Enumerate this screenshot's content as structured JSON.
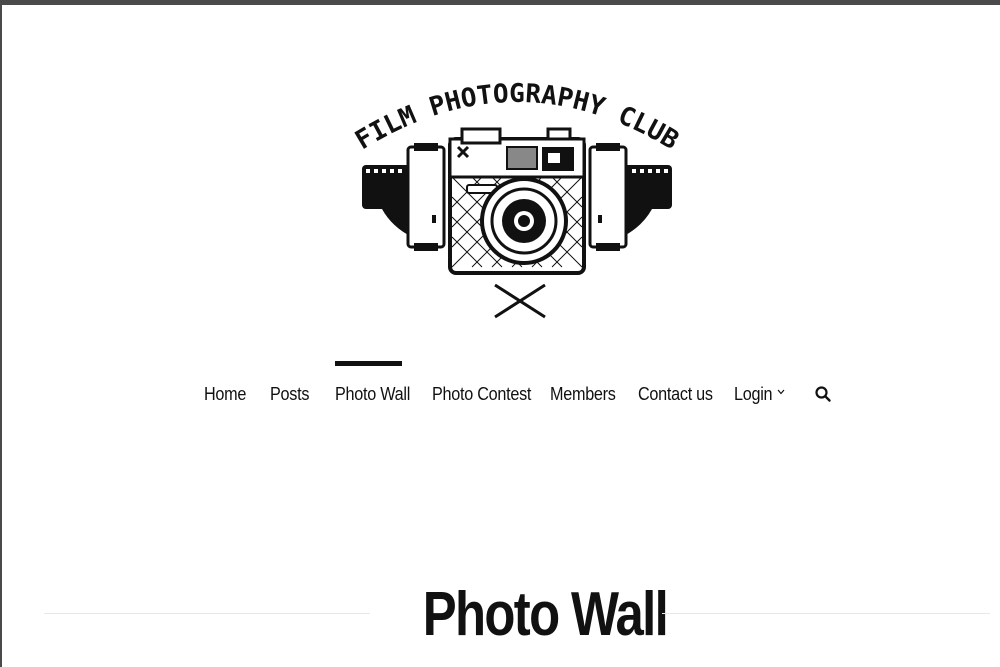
{
  "site": {
    "logo_text": "FILM PHOTOGRAPHY CLUB"
  },
  "nav": {
    "items": [
      {
        "label": "Home"
      },
      {
        "label": "Posts"
      },
      {
        "label": "Photo Wall",
        "active": true
      },
      {
        "label": "Photo Contest"
      },
      {
        "label": "Members"
      },
      {
        "label": "Contact us"
      },
      {
        "label": "Login",
        "has_dropdown": true
      }
    ],
    "search_icon": "search-icon",
    "dropdown_icon": "chevron-down-icon"
  },
  "page": {
    "title": "Photo Wall"
  }
}
